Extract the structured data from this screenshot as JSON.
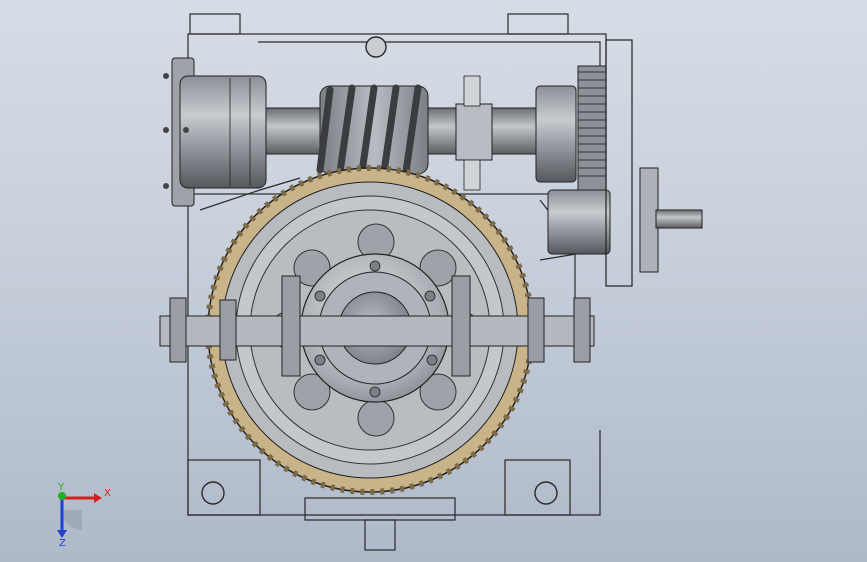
{
  "viewport": {
    "background_top": "#d7dde6",
    "background_bottom": "#aeb9c9"
  },
  "model": {
    "line_color": "#1b1b1b",
    "steel_dark": "#6f7278",
    "steel_mid": "#9ea3aa",
    "steel_light": "#c9ccd1",
    "bronze": "#c9b48a",
    "bronze_dark": "#8d7b57"
  },
  "triad": {
    "x_label": "X",
    "y_label": "Y",
    "z_label": "Z",
    "x_color": "#d62020",
    "y_color": "#20b020",
    "z_color": "#2040d0"
  }
}
